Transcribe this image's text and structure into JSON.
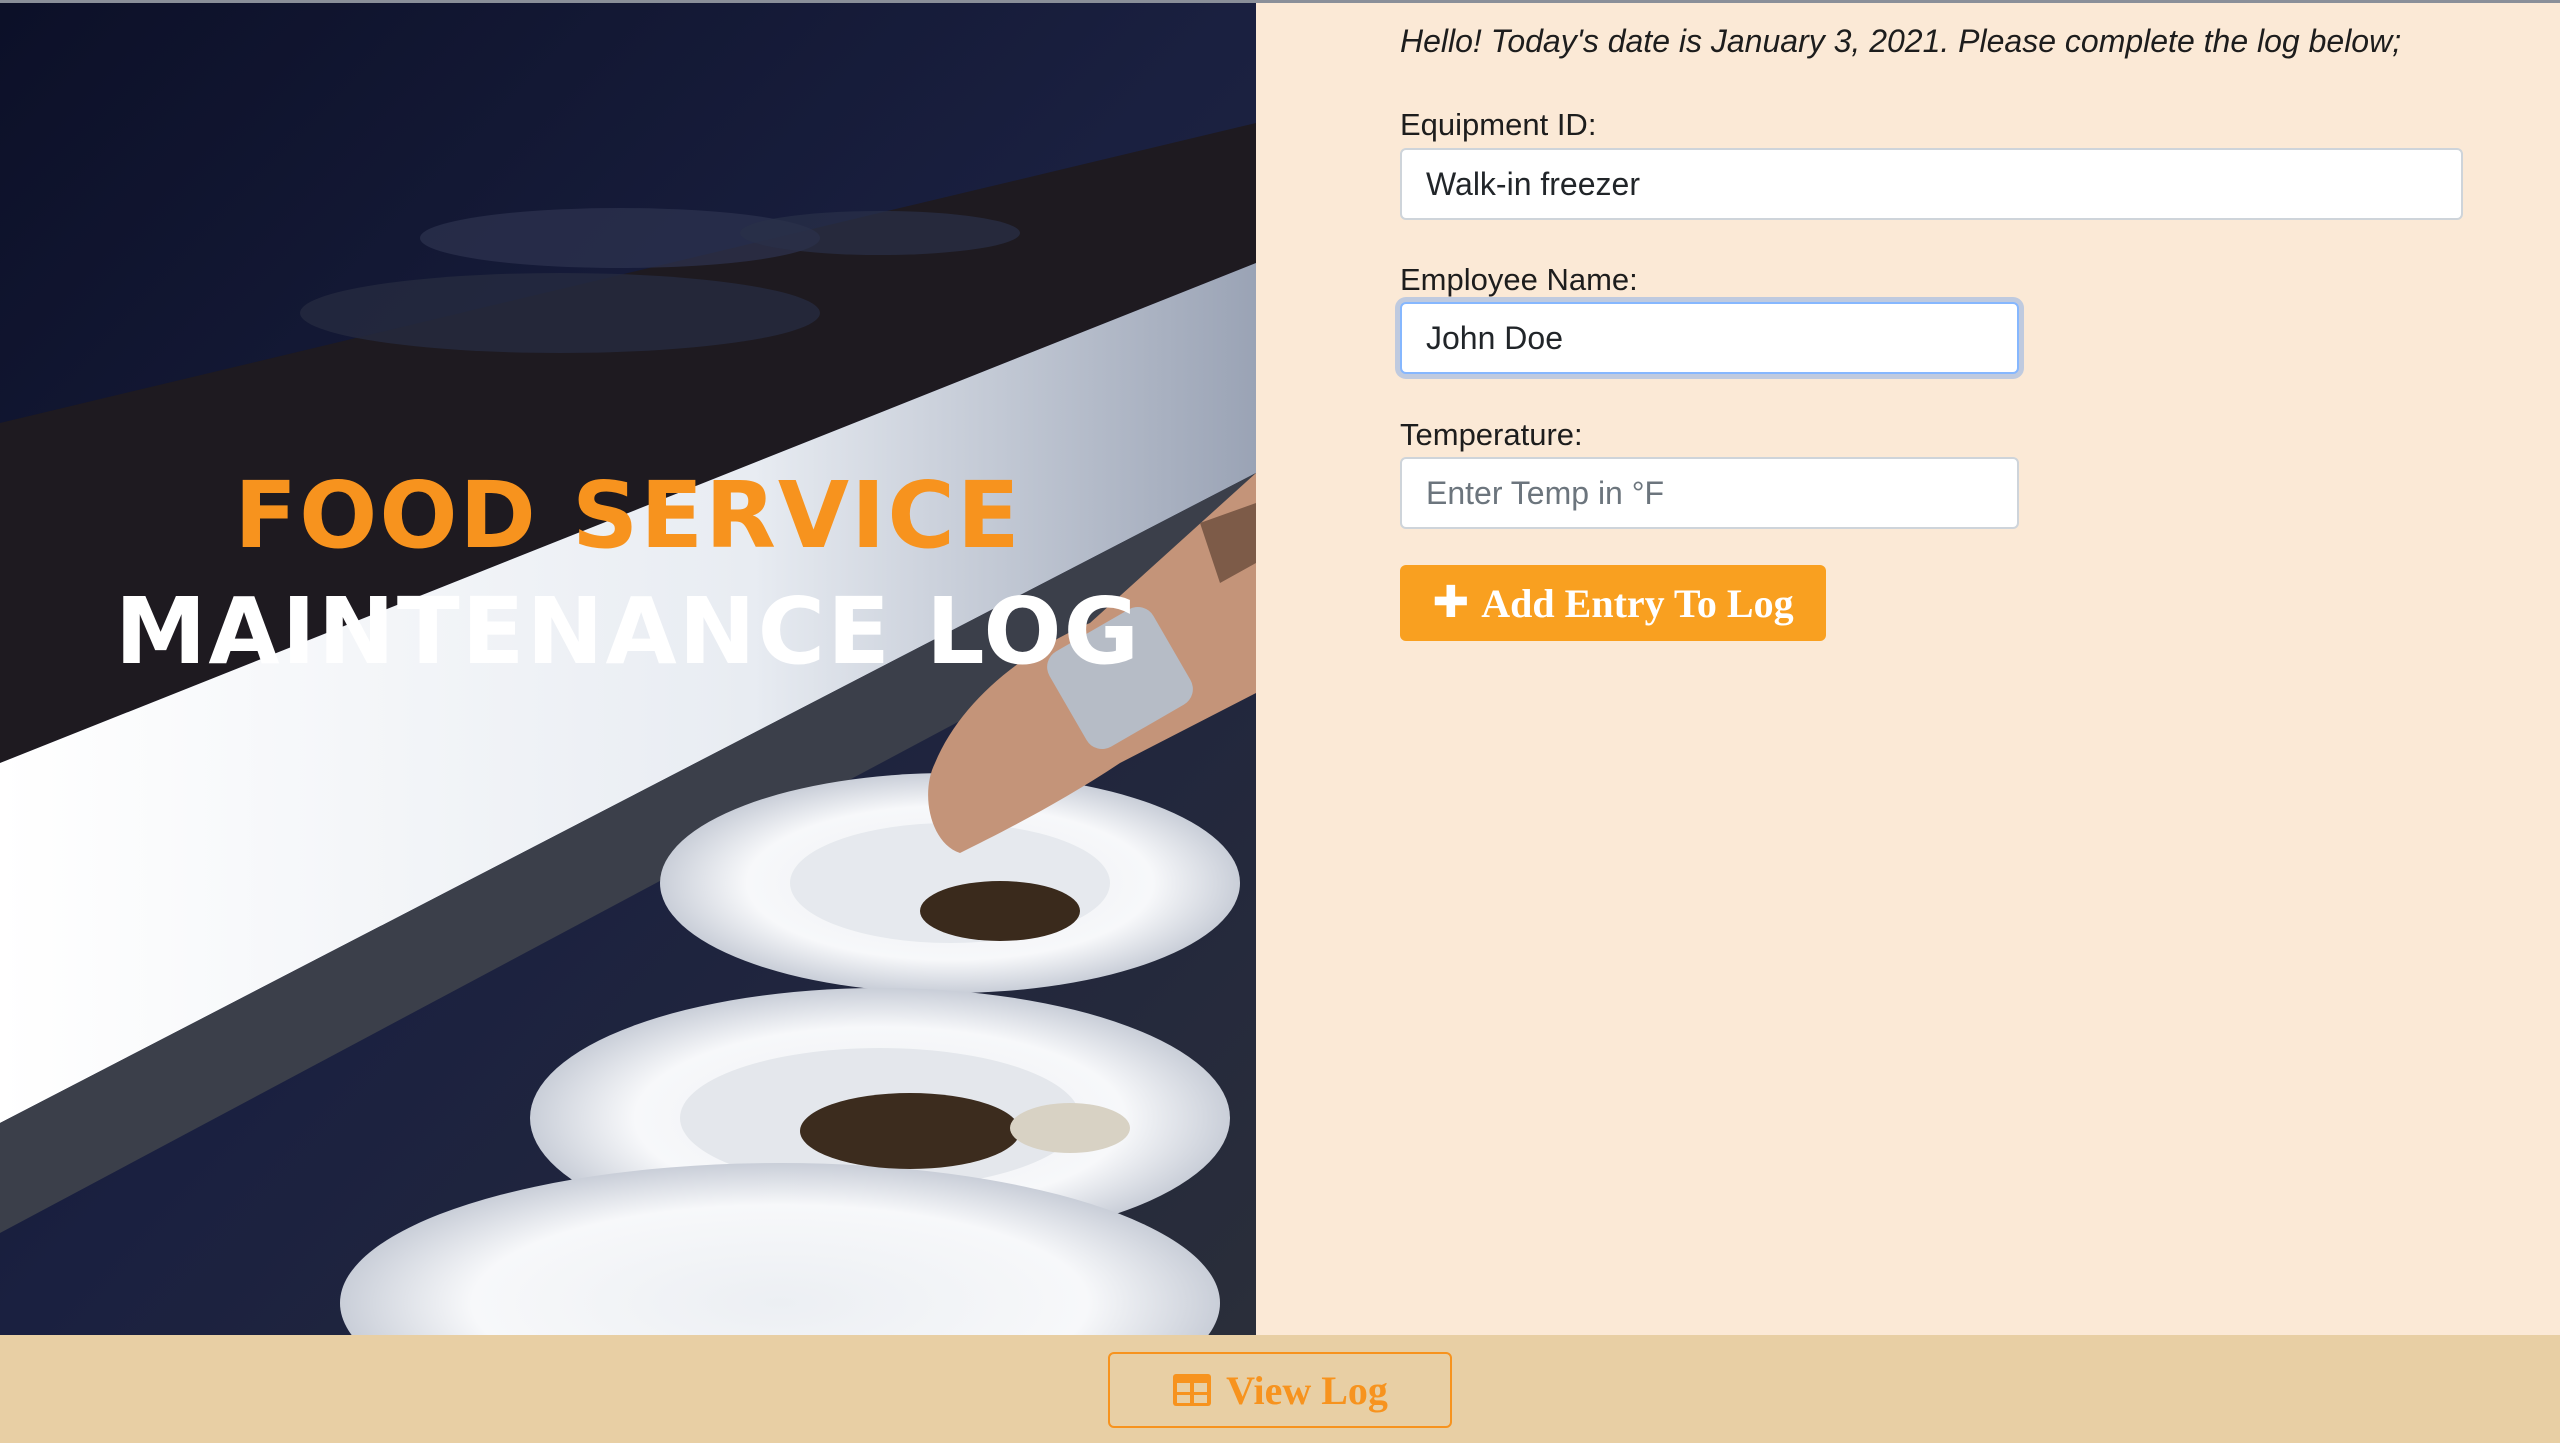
{
  "hero": {
    "title_line1": "FOOD SERVICE",
    "title_line2": "MAINTENANCE LOG"
  },
  "form": {
    "greeting": "Hello! Today's date is January 3, 2021. Please complete the log below;",
    "fields": [
      {
        "label": "Equipment ID:",
        "value": "Walk-in freezer",
        "placeholder": ""
      },
      {
        "label": "Employee Name:",
        "value": "John Doe",
        "placeholder": ""
      },
      {
        "label": "Temperature:",
        "value": "",
        "placeholder": "Enter Temp in °F"
      }
    ],
    "add_button": {
      "icon": "plus-icon",
      "label": "Add Entry To Log"
    }
  },
  "footer": {
    "view_button": {
      "icon": "table-icon",
      "label": "View Log"
    }
  },
  "colors": {
    "accent": "#f7931e",
    "form_background": "#fbe9d6",
    "footer_background": "#e8cfa4",
    "hero_dark": "#0f1430"
  }
}
